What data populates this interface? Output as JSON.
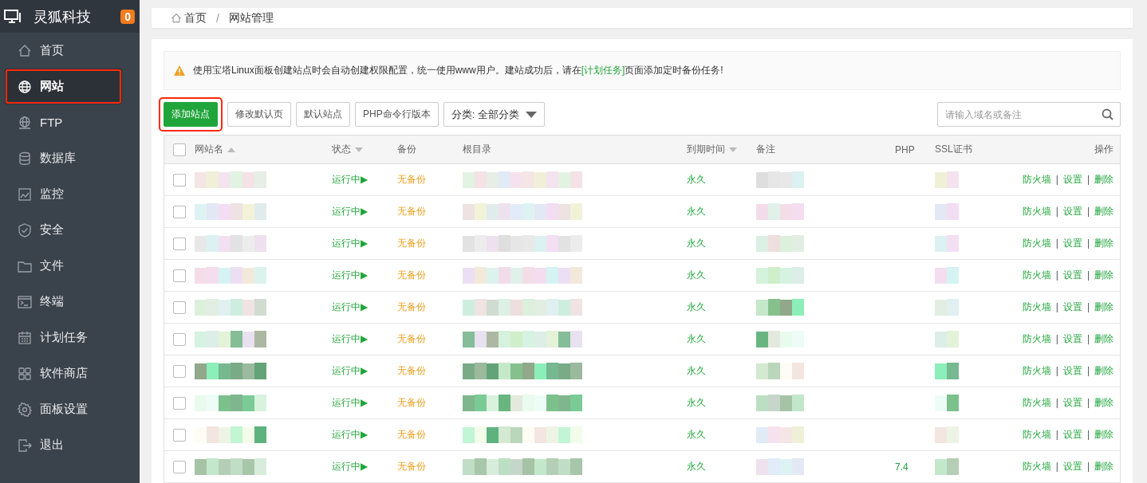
{
  "sidebar": {
    "brand": "灵狐科技",
    "badge": "0",
    "items": [
      {
        "label": "首页",
        "selected": false,
        "highlighted": false
      },
      {
        "label": "网站",
        "selected": true,
        "highlighted": true
      },
      {
        "label": "FTP",
        "selected": false,
        "highlighted": false
      },
      {
        "label": "数据库",
        "selected": false,
        "highlighted": false
      },
      {
        "label": "监控",
        "selected": false,
        "highlighted": false
      },
      {
        "label": "安全",
        "selected": false,
        "highlighted": false
      },
      {
        "label": "文件",
        "selected": false,
        "highlighted": false
      },
      {
        "label": "终端",
        "selected": false,
        "highlighted": false
      },
      {
        "label": "计划任务",
        "selected": false,
        "highlighted": false
      },
      {
        "label": "软件商店",
        "selected": false,
        "highlighted": false
      },
      {
        "label": "面板设置",
        "selected": false,
        "highlighted": false
      },
      {
        "label": "退出",
        "selected": false,
        "highlighted": false
      }
    ]
  },
  "breadcrumb": [
    {
      "kind": "link",
      "label": "首页"
    },
    {
      "kind": "separator",
      "label": "/"
    },
    {
      "kind": "current",
      "label": "网站管理"
    }
  ],
  "notice": {
    "text": "使用宝塔Linux面板创建站点时会自动创建权限配置，统一使用www用户。建站成功后，请在",
    "link": "[计划任务]",
    "after": "页面添加定时备份任务!"
  },
  "toolbar": {
    "buttons": [
      {
        "label": "添加站点",
        "primary": true,
        "highlighted": true
      },
      {
        "label": "修改默认页",
        "primary": false,
        "highlighted": false
      },
      {
        "label": "默认站点",
        "primary": false,
        "highlighted": false
      },
      {
        "label": "PHP命令行版本",
        "primary": false,
        "highlighted": false
      }
    ],
    "category": "分类: 全部分类",
    "search": {
      "placeholder": "请输入域名或备注"
    }
  },
  "table": {
    "select_all_checked": false,
    "columns": [
      {
        "label": "网站名",
        "ascending": true
      },
      {
        "label": "状态",
        "ascending": false
      },
      {
        "label": "备份"
      },
      {
        "label": "根目录"
      },
      {
        "label": "到期时间",
        "ascending": false
      },
      {
        "label": "备注"
      },
      {
        "label": "PHP"
      },
      {
        "label": "SSL证书"
      },
      {
        "label": "操作"
      }
    ],
    "rows": [
      {
        "checked": false,
        "status": "运行中▶",
        "backup": "无备份",
        "expiry": "永久",
        "actions": [
          {
            "kind": "link",
            "label": "防火墙"
          },
          {
            "kind": "separator",
            "label": "|"
          },
          {
            "kind": "link",
            "label": "设置"
          },
          {
            "kind": "separator",
            "label": "|"
          },
          {
            "kind": "link",
            "label": "删除"
          }
        ]
      },
      {
        "checked": false,
        "status": "运行中▶",
        "backup": "无备份",
        "expiry": "永久",
        "actions": [
          {
            "kind": "link",
            "label": "防火墙"
          },
          {
            "kind": "separator",
            "label": "|"
          },
          {
            "kind": "link",
            "label": "设置"
          },
          {
            "kind": "separator",
            "label": "|"
          },
          {
            "kind": "link",
            "label": "删除"
          }
        ]
      },
      {
        "checked": false,
        "status": "运行中▶",
        "backup": "无备份",
        "expiry": "永久",
        "actions": [
          {
            "kind": "link",
            "label": "防火墙"
          },
          {
            "kind": "separator",
            "label": "|"
          },
          {
            "kind": "link",
            "label": "设置"
          },
          {
            "kind": "separator",
            "label": "|"
          },
          {
            "kind": "link",
            "label": "删除"
          }
        ]
      },
      {
        "checked": false,
        "status": "运行中▶",
        "backup": "无备份",
        "expiry": "永久",
        "actions": [
          {
            "kind": "link",
            "label": "防火墙"
          },
          {
            "kind": "separator",
            "label": "|"
          },
          {
            "kind": "link",
            "label": "设置"
          },
          {
            "kind": "separator",
            "label": "|"
          },
          {
            "kind": "link",
            "label": "删除"
          }
        ]
      },
      {
        "checked": false,
        "status": "运行中▶",
        "backup": "无备份",
        "expiry": "永久",
        "actions": [
          {
            "kind": "link",
            "label": "防火墙"
          },
          {
            "kind": "separator",
            "label": "|"
          },
          {
            "kind": "link",
            "label": "设置"
          },
          {
            "kind": "separator",
            "label": "|"
          },
          {
            "kind": "link",
            "label": "删除"
          }
        ]
      },
      {
        "checked": false,
        "status": "运行中▶",
        "backup": "无备份",
        "expiry": "永久",
        "actions": [
          {
            "kind": "link",
            "label": "防火墙"
          },
          {
            "kind": "separator",
            "label": "|"
          },
          {
            "kind": "link",
            "label": "设置"
          },
          {
            "kind": "separator",
            "label": "|"
          },
          {
            "kind": "link",
            "label": "删除"
          }
        ]
      },
      {
        "checked": false,
        "status": "运行中▶",
        "backup": "无备份",
        "expiry": "永久",
        "actions": [
          {
            "kind": "link",
            "label": "防火墙"
          },
          {
            "kind": "separator",
            "label": "|"
          },
          {
            "kind": "link",
            "label": "设置"
          },
          {
            "kind": "separator",
            "label": "|"
          },
          {
            "kind": "link",
            "label": "删除"
          }
        ]
      },
      {
        "checked": false,
        "status": "运行中▶",
        "backup": "无备份",
        "expiry": "永久",
        "actions": [
          {
            "kind": "link",
            "label": "防火墙"
          },
          {
            "kind": "separator",
            "label": "|"
          },
          {
            "kind": "link",
            "label": "设置"
          },
          {
            "kind": "separator",
            "label": "|"
          },
          {
            "kind": "link",
            "label": "删除"
          }
        ]
      },
      {
        "checked": false,
        "status": "运行中▶",
        "backup": "无备份",
        "expiry": "永久",
        "actions": [
          {
            "kind": "link",
            "label": "防火墙"
          },
          {
            "kind": "separator",
            "label": "|"
          },
          {
            "kind": "link",
            "label": "设置"
          },
          {
            "kind": "separator",
            "label": "|"
          },
          {
            "kind": "link",
            "label": "删除"
          }
        ]
      },
      {
        "checked": false,
        "status": "运行中▶",
        "backup": "无备份",
        "expiry": "永久",
        "php": "7.4",
        "actions": [
          {
            "kind": "link",
            "label": "防火墙"
          },
          {
            "kind": "separator",
            "label": "|"
          },
          {
            "kind": "link",
            "label": "设置"
          },
          {
            "kind": "separator",
            "label": "|"
          },
          {
            "kind": "link",
            "label": "删除"
          }
        ]
      }
    ]
  }
}
